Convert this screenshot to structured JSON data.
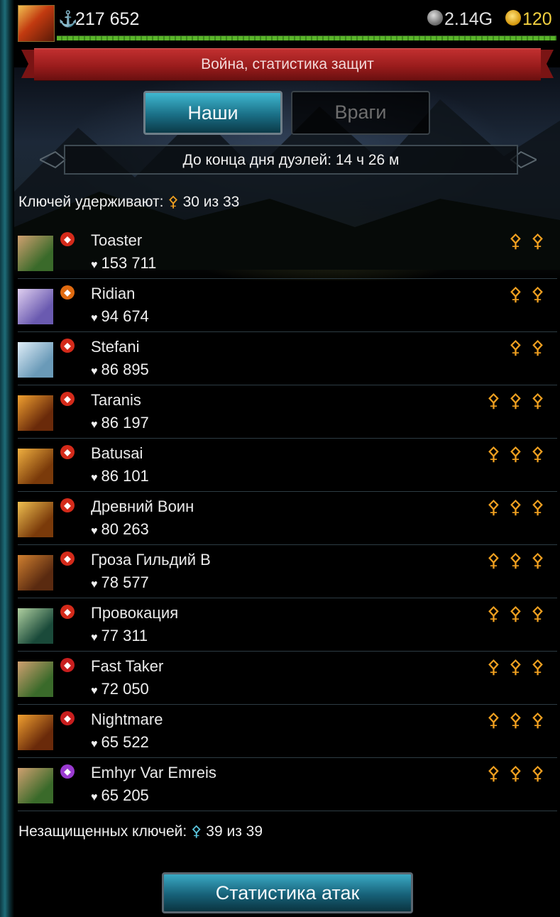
{
  "header": {
    "score": "217 652",
    "gems": "2.14G",
    "coins": "120",
    "progress": 1.0
  },
  "title": "Война, статистика защит",
  "tabs": {
    "ours": "Наши",
    "enemies": "Враги"
  },
  "timer": "До конца дня дуэлей: 14 ч 26 м",
  "keys_held": {
    "label": "Ключей удерживают:",
    "value": "30 из 33"
  },
  "members": [
    {
      "name": "Toaster",
      "power": "153 711",
      "keys": "⚴⚴",
      "rank_color": "#d42a1a",
      "avatar": [
        "#3a6a2a",
        "#d0a070"
      ]
    },
    {
      "name": "Ridian",
      "power": "94 674",
      "keys": "⚴⚴",
      "rank_color": "#e06a10",
      "avatar": [
        "#6a5ab0",
        "#e0d0f0"
      ]
    },
    {
      "name": "Stefani",
      "power": "86 895",
      "keys": "⚴⚴",
      "rank_color": "#d42a1a",
      "avatar": [
        "#6a9ab8",
        "#e0eef8"
      ]
    },
    {
      "name": "Taranis",
      "power": "86 197",
      "keys": "⚴⚴⚴",
      "rank_color": "#d42a1a",
      "avatar": [
        "#6a2a0a",
        "#f0a030"
      ]
    },
    {
      "name": "Batusai",
      "power": "86 101",
      "keys": "⚴⚴⚴",
      "rank_color": "#d42a1a",
      "avatar": [
        "#7a3a0a",
        "#f0b040"
      ]
    },
    {
      "name": "Древний Воин",
      "power": "80 263",
      "keys": "⚴⚴⚴",
      "rank_color": "#d42a1a",
      "avatar": [
        "#7a3a0a",
        "#f0c050"
      ]
    },
    {
      "name": "Гроза Гильдий В",
      "power": "78 577",
      "keys": "⚴⚴⚴",
      "rank_color": "#d42a1a",
      "avatar": [
        "#5a2a10",
        "#d08030"
      ]
    },
    {
      "name": "Провокация",
      "power": "77 311",
      "keys": "⚴⚴⚴",
      "rank_color": "#d42a1a",
      "avatar": [
        "#1a4a3a",
        "#b0d0a0"
      ]
    },
    {
      "name": "Fast Taker",
      "power": "72 050",
      "keys": "⚴⚴⚴",
      "rank_color": "#c81e1e",
      "avatar": [
        "#3a6a2a",
        "#d0a070"
      ]
    },
    {
      "name": "Nightmare",
      "power": "65 522",
      "keys": "⚴⚴⚴",
      "rank_color": "#c81e1e",
      "avatar": [
        "#6a2a0a",
        "#f0a030"
      ]
    },
    {
      "name": "Emhyr Var Emreis",
      "power": "65 205",
      "keys": "⚴⚴⚴",
      "rank_color": "#9a3ad0",
      "avatar": [
        "#3a6a2a",
        "#d0a070"
      ]
    }
  ],
  "unprotected": {
    "label": "Незащищенных ключей:",
    "value": "39 из 39"
  },
  "attack_stats_button": "Статистика атак",
  "icons": {
    "anchor": "anchor-icon",
    "gem": "gem-icon",
    "coin": "coin-icon",
    "key": "key-icon",
    "heart": "heart-icon",
    "rank": "rank-badge-icon"
  }
}
